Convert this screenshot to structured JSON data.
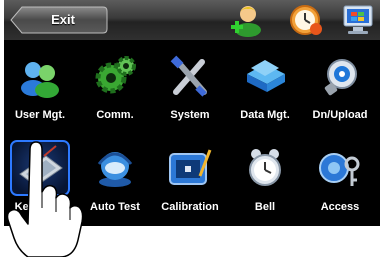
{
  "topbar": {
    "exit_label": "Exit",
    "icons": [
      "user-add-icon",
      "alarm-clock-icon",
      "monitor-icon"
    ]
  },
  "menu": {
    "rows": [
      [
        {
          "label": "User Mgt.",
          "icon": "users-icon"
        },
        {
          "label": "Comm.",
          "icon": "gears-icon"
        },
        {
          "label": "System",
          "icon": "tools-icon"
        },
        {
          "label": "Data Mgt.",
          "icon": "database-icon"
        },
        {
          "label": "Dn/Upload",
          "icon": "usb-disc-icon"
        }
      ],
      [
        {
          "label": "Keyboard",
          "icon": "keyboard-icon",
          "selected": true
        },
        {
          "label": "Auto Test",
          "icon": "headset-icon"
        },
        {
          "label": "Calibration",
          "icon": "calibration-icon"
        },
        {
          "label": "Bell",
          "icon": "bell-icon"
        },
        {
          "label": "Access",
          "icon": "keys-icon"
        }
      ]
    ]
  },
  "colors": {
    "screen_bg": "#000000",
    "selection_border": "#2d79ff",
    "label_text": "#ffffff"
  }
}
